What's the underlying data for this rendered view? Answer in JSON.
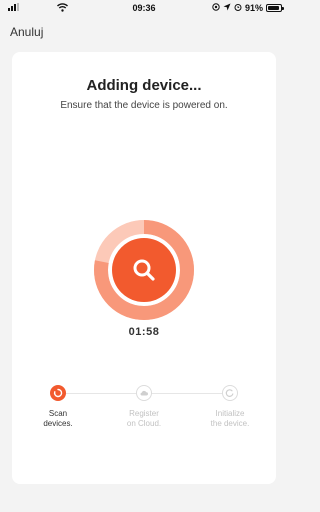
{
  "status_bar": {
    "time": "09:36",
    "battery": "91%",
    "battery_level": 0.91
  },
  "header": {
    "cancel_label": "Anuluj"
  },
  "main": {
    "title": "Adding device...",
    "subtitle": "Ensure that the device is powered on.",
    "timer": "01:58",
    "progress": 0.78,
    "accent_color": "#f25a2e",
    "icon": "search-icon"
  },
  "steps": [
    {
      "label": "Scan\ndevices.",
      "state": "active",
      "icon": "spinner-icon"
    },
    {
      "label": "Register\non Cloud.",
      "state": "inactive",
      "icon": "cloud-icon"
    },
    {
      "label": "Initialize\nthe device.",
      "state": "inactive",
      "icon": "power-icon"
    }
  ]
}
